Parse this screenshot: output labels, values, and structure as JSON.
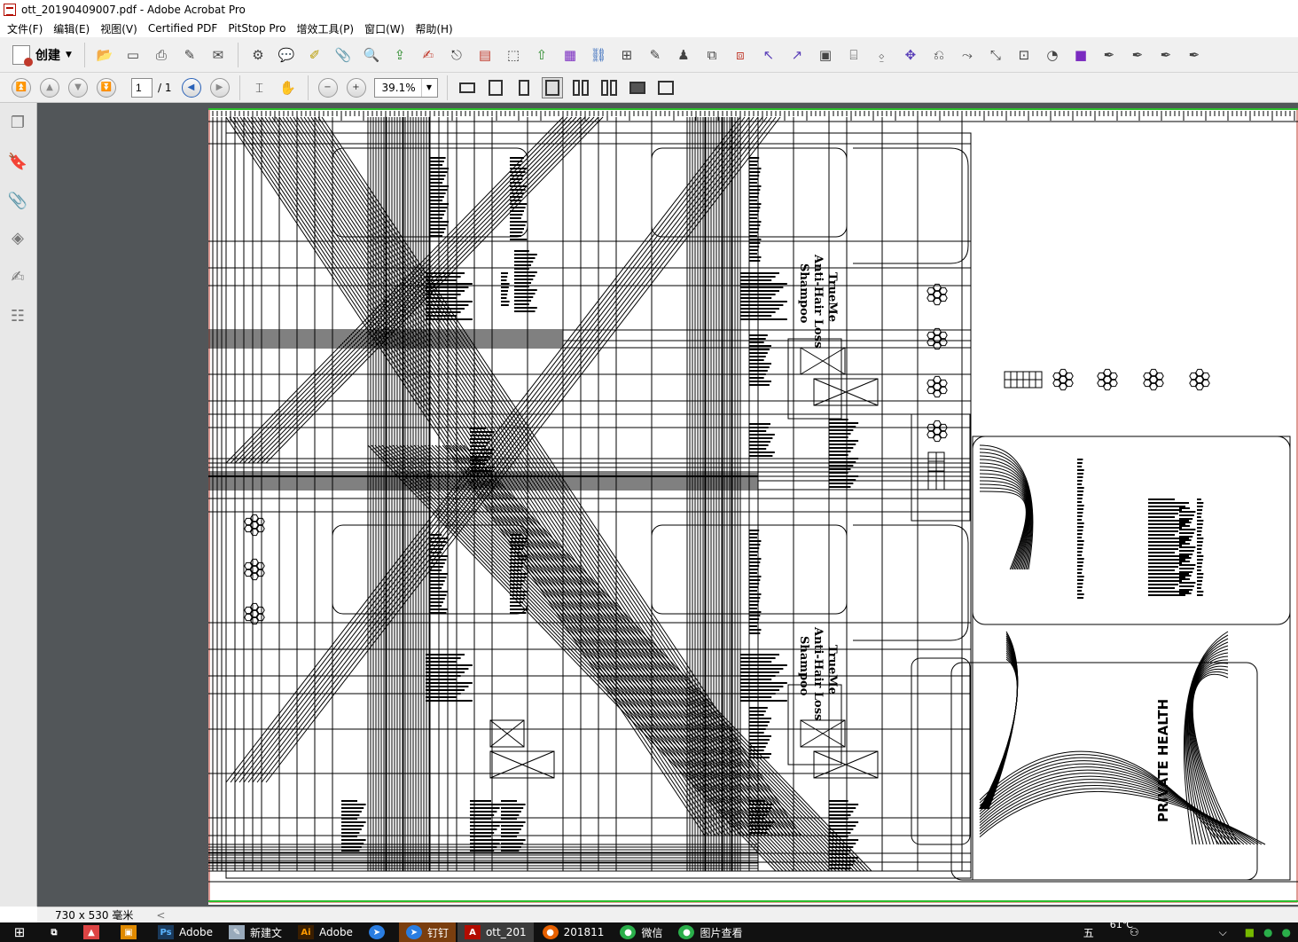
{
  "window": {
    "title": "ott_20190409007.pdf - Adobe Acrobat Pro"
  },
  "menu": [
    "文件(F)",
    "编辑(E)",
    "视图(V)",
    "Certified PDF",
    "PitStop Pro",
    "增效工具(P)",
    "窗口(W)",
    "帮助(H)"
  ],
  "toolbar": {
    "create_label": "创建",
    "icons": [
      "open-icon",
      "save-icon",
      "print-icon",
      "edit-icon",
      "email-icon",
      "settings-icon",
      "comment-icon",
      "highlight-icon",
      "attach-icon",
      "search-icon",
      "export-icon",
      "sign-icon",
      "share-icon",
      "form-icon",
      "select-icon",
      "upload-icon",
      "color-icon",
      "links-icon",
      "link-icon",
      "review-icon",
      "stamp-icon",
      "crop-icon",
      "redact-icon",
      "pointer-icon",
      "measure-icon",
      "compare-icon",
      "ruler-icon",
      "object-icon",
      "move-icon",
      "rotate-icon",
      "transform-icon",
      "scale-icon",
      "text-edit-icon",
      "path-icon",
      "gradient-icon",
      "pen-icon",
      "pen-add-icon",
      "pen-delete-icon",
      "pen-convert-icon"
    ]
  },
  "nav": {
    "page_current": "1",
    "page_total": "/ 1",
    "zoom": "39.1%"
  },
  "status": {
    "dimensions": "730 x 530 毫米"
  },
  "taskbar": {
    "items": [
      {
        "label": "",
        "icon": "taskview-icon"
      },
      {
        "label": "",
        "icon": "app-colorful-icon"
      },
      {
        "label": "",
        "icon": "app-box-icon"
      },
      {
        "label": "Adobe",
        "icon": "photoshop-icon"
      },
      {
        "label": "新建文",
        "icon": "notepad-icon"
      },
      {
        "label": "Adobe",
        "icon": "illustrator-icon"
      },
      {
        "label": "",
        "icon": "app-blue-icon"
      },
      {
        "label": "钉钉",
        "icon": "dingtalk-icon"
      },
      {
        "label": "ott_201",
        "icon": "acrobat-icon"
      },
      {
        "label": "201811",
        "icon": "firefox-icon"
      },
      {
        "label": "微信",
        "icon": "wechat-icon"
      },
      {
        "label": "图片查看",
        "icon": "photo-viewer-icon"
      }
    ],
    "ime": "五",
    "temp": "61℃"
  },
  "artwork": {
    "panels": [
      {
        "brand": "TrueMe",
        "product": "Anti-Hair Loss",
        "type": "Shampoo"
      },
      {
        "brand": "TrueMe",
        "product": "Anti-Hair Loss",
        "type": "Shampoo"
      }
    ],
    "side_text": "PRIVATE HEALTH"
  },
  "colors": {
    "chrome": "#f0f0f0",
    "workspace": "#525659",
    "taskbar": "#111111",
    "accent_red": "#c0392b",
    "accent_blue": "#2a62b8"
  }
}
